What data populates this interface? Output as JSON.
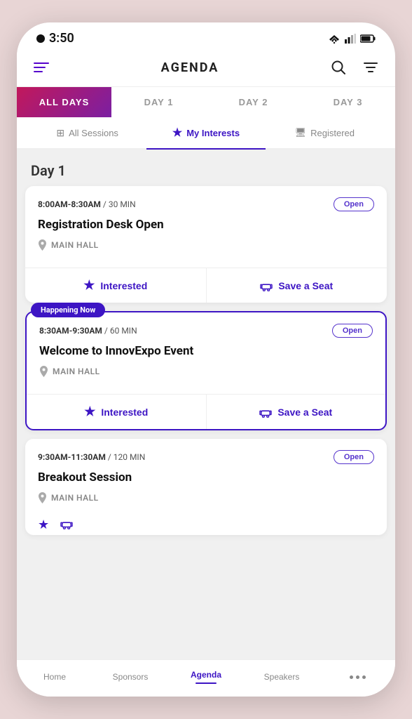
{
  "statusBar": {
    "time": "3:50"
  },
  "header": {
    "title": "AGENDA",
    "menuLabel": "menu",
    "searchLabel": "search",
    "filterLabel": "filter"
  },
  "dayTabs": [
    {
      "id": "all",
      "label": "ALL DAYS",
      "active": true
    },
    {
      "id": "day1",
      "label": "DAY 1",
      "active": false
    },
    {
      "id": "day2",
      "label": "DAY 2",
      "active": false
    },
    {
      "id": "day3",
      "label": "DAY 3",
      "active": false
    }
  ],
  "filterTabs": [
    {
      "id": "all-sessions",
      "label": "All Sessions",
      "icon": "📋",
      "active": false
    },
    {
      "id": "my-interests",
      "label": "My Interests",
      "icon": "★",
      "active": true
    },
    {
      "id": "registered",
      "label": "Registered",
      "icon": "🖥",
      "active": false
    }
  ],
  "dayLabel": "Day 1",
  "sessions": [
    {
      "id": "s1",
      "timeRange": "8:00AM-8:30AM",
      "duration": "30 MIN",
      "title": "Registration Desk Open",
      "location": "MAIN HALL",
      "badge": "Open",
      "happeningNow": false,
      "interestedLabel": "Interested",
      "saveSeatLabel": "Save a Seat"
    },
    {
      "id": "s2",
      "timeRange": "8:30AM-9:30AM",
      "duration": "60 MIN",
      "title": "Welcome to InnovExpo Event",
      "location": "MAIN HALL",
      "badge": "Open",
      "happeningNow": true,
      "happeningNowLabel": "Happening Now",
      "interestedLabel": "Interested",
      "saveSeatLabel": "Save a Seat"
    },
    {
      "id": "s3",
      "timeRange": "9:30AM-11:30AM",
      "duration": "120 MIN",
      "title": "Breakout Session",
      "location": "MAIN HALL",
      "badge": "Open",
      "happeningNow": false,
      "interestedLabel": "Interested",
      "saveSeatLabel": "Save a Seat"
    }
  ],
  "bottomNav": [
    {
      "id": "home",
      "label": "Home",
      "active": false
    },
    {
      "id": "sponsors",
      "label": "Sponsors",
      "active": false
    },
    {
      "id": "agenda",
      "label": "Agenda",
      "active": true
    },
    {
      "id": "speakers",
      "label": "Speakers",
      "active": false
    },
    {
      "id": "more",
      "label": "···",
      "active": false
    }
  ]
}
